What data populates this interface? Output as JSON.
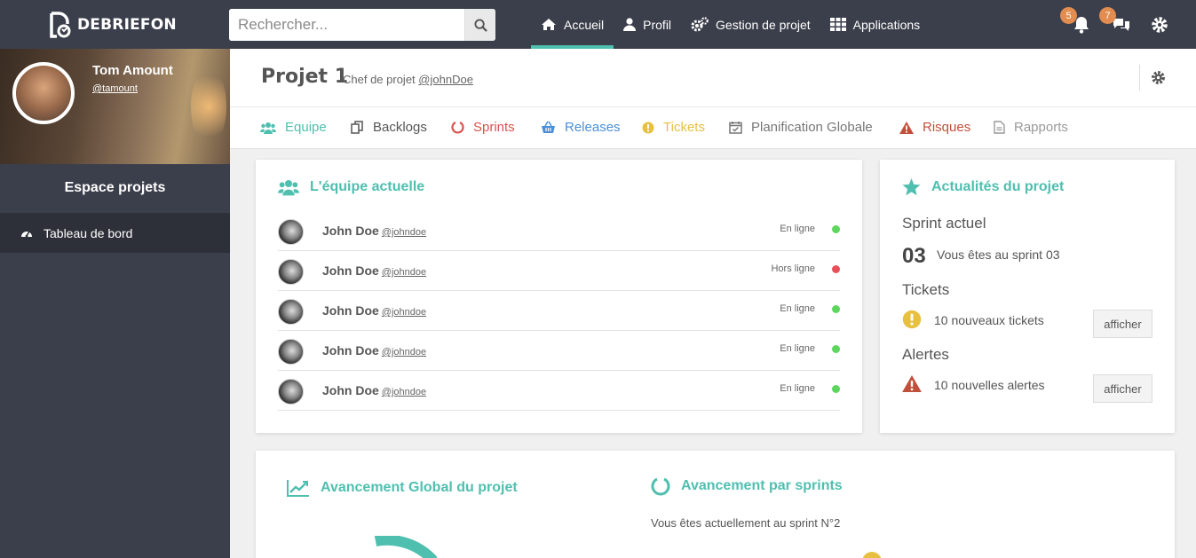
{
  "brand": {
    "name": "DEBRIEFON"
  },
  "search": {
    "placeholder": "Rechercher..."
  },
  "nav": [
    {
      "label": "Accueil",
      "icon": "home-icon",
      "active": true
    },
    {
      "label": "Profil",
      "icon": "user-icon"
    },
    {
      "label": "Gestion de projet",
      "icon": "cogs-icon"
    },
    {
      "label": "Applications",
      "icon": "grid-icon"
    }
  ],
  "notifications": {
    "bell_count": "5",
    "chat_count": "7"
  },
  "user": {
    "name": "Tom Amount",
    "handle": "@tamount"
  },
  "sidebar": {
    "title": "Espace projets",
    "items": [
      {
        "label": "Tableau de bord",
        "icon": "dashboard-icon"
      }
    ]
  },
  "project": {
    "title": "Projet 1",
    "subtitle_prefix": "Chef de projet",
    "manager": "@johnDoe"
  },
  "tabs": [
    {
      "label": "Equipe",
      "icon": "users-icon",
      "color": "#4fbfaf"
    },
    {
      "label": "Backlogs",
      "icon": "copy-icon",
      "color": "#555555"
    },
    {
      "label": "Sprints",
      "icon": "circle-notch-icon",
      "color": "#d9534f"
    },
    {
      "label": "Releases",
      "icon": "basket-icon",
      "color": "#4a90d9"
    },
    {
      "label": "Tickets",
      "icon": "exclamation-circle-icon",
      "color": "#e8c040"
    },
    {
      "label": "Planification Globale",
      "icon": "calendar-check-icon",
      "color": "#777777"
    },
    {
      "label": "Risques",
      "icon": "warning-icon",
      "color": "#c0503b"
    },
    {
      "label": "Rapports",
      "icon": "file-icon",
      "color": "#999999"
    }
  ],
  "team": {
    "title": "L'équipe actuelle",
    "members": [
      {
        "name": "John Doe",
        "handle": "@johndoe",
        "status": "En ligne",
        "online": true
      },
      {
        "name": "John Doe",
        "handle": "@johndoe",
        "status": "Hors ligne",
        "online": false
      },
      {
        "name": "John Doe",
        "handle": "@johndoe",
        "status": "En ligne",
        "online": true
      },
      {
        "name": "John Doe",
        "handle": "@johndoe",
        "status": "En ligne",
        "online": true
      },
      {
        "name": "John Doe",
        "handle": "@johndoe",
        "status": "En ligne",
        "online": true
      }
    ]
  },
  "news": {
    "title": "Actualités du projet",
    "sprint_label": "Sprint actuel",
    "sprint_number": "03",
    "sprint_text": "Vous êtes au sprint 03",
    "tickets_label": "Tickets",
    "tickets_text": "10 nouveaux tickets",
    "alerts_label": "Alertes",
    "alerts_text": "10 nouvelles alertes",
    "button_label": "afficher"
  },
  "progress": {
    "global_title": "Avancement Global du projet",
    "sprints_title": "Avancement par sprints",
    "sprints_text": "Vous êtes actuellement au sprint N°2"
  },
  "colors": {
    "accent": "#4fbfaf",
    "topbar": "#3b3f4b",
    "online": "#5cd65c",
    "offline": "#e8515a",
    "badge": "#e28c4f"
  }
}
